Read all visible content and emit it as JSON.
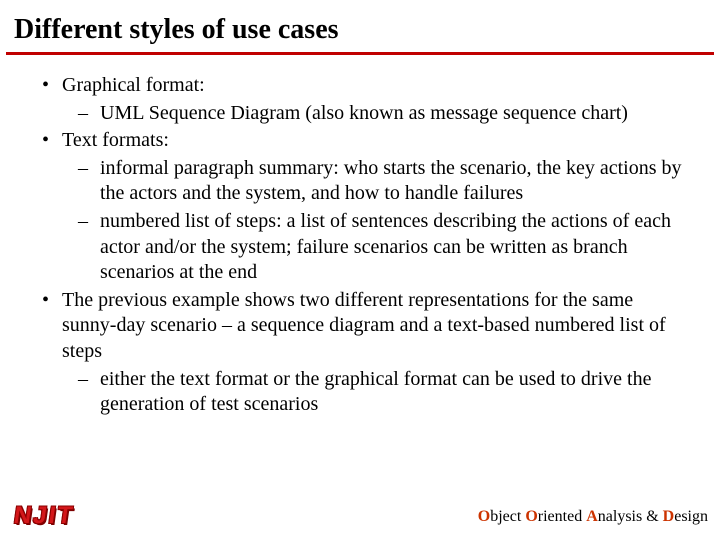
{
  "title": "Different styles of use cases",
  "bullets": {
    "b1": "Graphical format:",
    "b1_1": "UML Sequence Diagram (also known as message sequence chart)",
    "b2": "Text formats:",
    "b2_1": "informal paragraph summary: who starts the scenario, the key actions by the actors and the system, and how to handle failures",
    "b2_2": "numbered list of steps: a list of sentences describing the actions of each actor and/or the system; failure scenarios can be written as branch scenarios at the end",
    "b3": "The previous example shows two different representations for the same sunny-day scenario – a sequence diagram and a text-based numbered list of steps",
    "b3_1": "either the text format or the graphical format can be used to drive the generation of test scenarios"
  },
  "logo": "NJIT",
  "tagline": {
    "o": "O",
    "object": "bject ",
    "o2": "O",
    "oriented": "riented ",
    "a": "A",
    "analysis": "nalysis & ",
    "d": "D",
    "design": "esign"
  }
}
